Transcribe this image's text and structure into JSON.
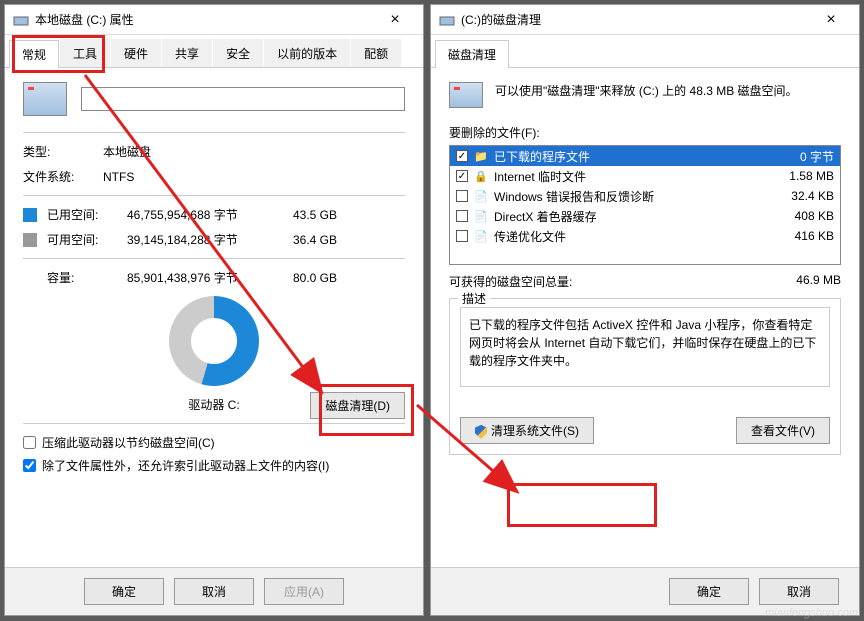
{
  "left": {
    "title": "本地磁盘 (C:) 属性",
    "tabs": [
      "常规",
      "工具",
      "硬件",
      "共享",
      "安全",
      "以前的版本",
      "配额"
    ],
    "type_label": "类型:",
    "type_value": "本地磁盘",
    "fs_label": "文件系统:",
    "fs_value": "NTFS",
    "used_label": "已用空间:",
    "used_bytes": "46,755,954,688 字节",
    "used_size": "43.5 GB",
    "free_label": "可用空间:",
    "free_bytes": "39,145,184,288 字节",
    "free_size": "36.4 GB",
    "cap_label": "容量:",
    "cap_bytes": "85,901,438,976 字节",
    "cap_size": "80.0 GB",
    "drive_label": "驱动器 C:",
    "cleanup_btn": "磁盘清理(D)",
    "compress": "压缩此驱动器以节约磁盘空间(C)",
    "index": "除了文件属性外，还允许索引此驱动器上文件的内容(I)",
    "ok": "确定",
    "cancel": "取消",
    "apply": "应用(A)"
  },
  "right": {
    "title": "(C:)的磁盘清理",
    "tab": "磁盘清理",
    "summary": "可以使用\"磁盘清理\"来释放  (C:) 上的 48.3 MB 磁盘空间。",
    "files_label": "要删除的文件(F):",
    "items": [
      {
        "checked": true,
        "icon": "folder",
        "name": "已下载的程序文件",
        "size": "0 字节",
        "selected": true
      },
      {
        "checked": true,
        "icon": "lock",
        "name": "Internet 临时文件",
        "size": "1.58 MB"
      },
      {
        "checked": false,
        "icon": "doc",
        "name": "Windows 错误报告和反馈诊断",
        "size": "32.4 KB"
      },
      {
        "checked": false,
        "icon": "doc",
        "name": "DirectX 着色器缓存",
        "size": "408 KB"
      },
      {
        "checked": false,
        "icon": "doc",
        "name": "传递优化文件",
        "size": "416 KB"
      }
    ],
    "total_label": "可获得的磁盘空间总量:",
    "total_value": "46.9 MB",
    "desc_label": "描述",
    "desc_text": "已下载的程序文件包括 ActiveX 控件和 Java 小程序，你查看特定网页时将会从 Internet 自动下载它们，并临时保存在硬盘上的已下载的程序文件夹中。",
    "clean_sys": "清理系统文件(S)",
    "view_files": "查看文件(V)",
    "ok": "确定",
    "cancel": "取消"
  }
}
